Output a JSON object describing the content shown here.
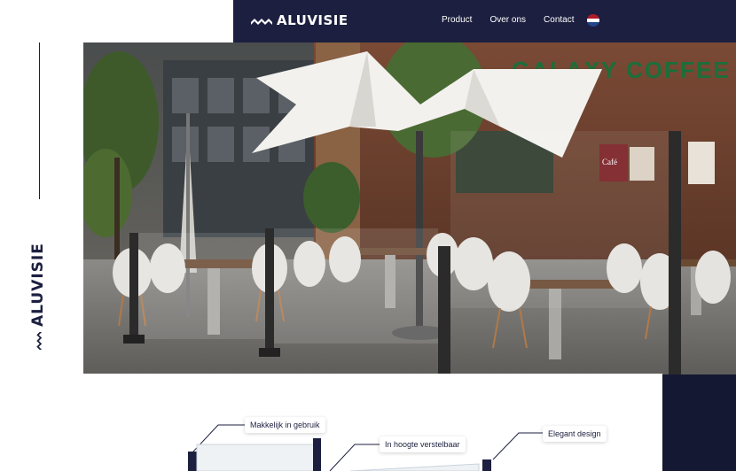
{
  "brand": {
    "name": "ALUVISIE"
  },
  "nav": {
    "items": [
      "Product",
      "Over ons",
      "Contact"
    ],
    "language_flag": "nl-flag-icon"
  },
  "hero": {
    "sign_text": "GALAXY COFFEE",
    "poster_text": "Café"
  },
  "features": {
    "items": [
      "Makkelijk in gebruik",
      "In hoogte verstelbaar",
      "Elegant design"
    ]
  },
  "colors": {
    "navy": "#1c1f3f",
    "dark_navy": "#151833",
    "white": "#ffffff",
    "flag_red": "#ae1c28",
    "flag_blue": "#21468b"
  }
}
